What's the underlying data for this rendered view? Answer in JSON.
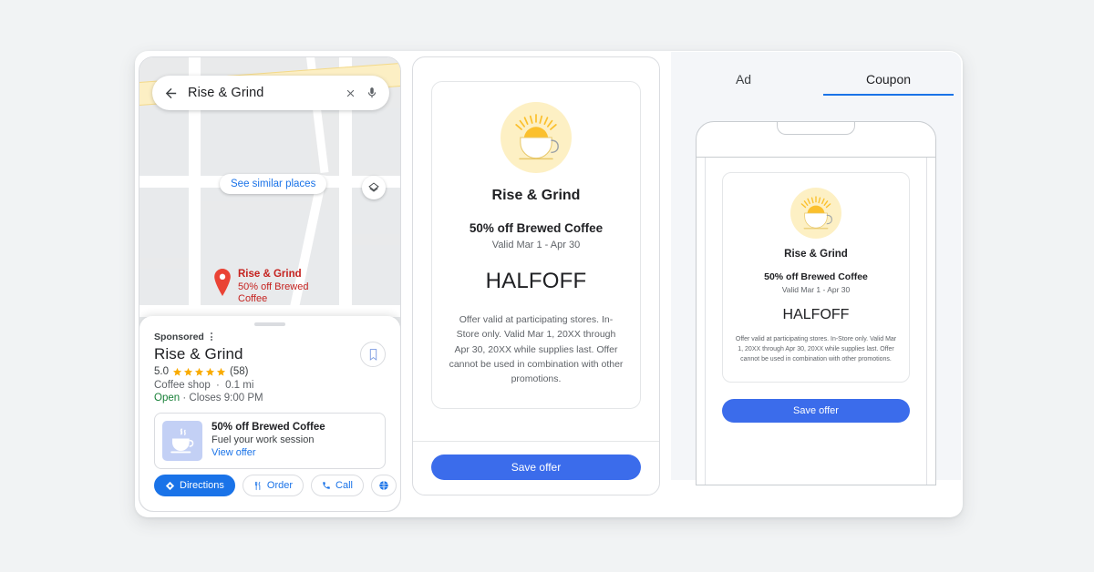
{
  "map_panel": {
    "search": {
      "value": "Rise & Grind",
      "back_icon": "back-arrow-icon",
      "clear_icon": "close-icon",
      "mic_icon": "microphone-icon"
    },
    "similar_chip": "See similar places",
    "layers_icon": "layers-icon",
    "locate_icon": "my-location-icon",
    "poi": {
      "title": "Rise & Grind",
      "subtitle": "50% off Brewed Coffee",
      "pin_icon": "map-pin-icon"
    },
    "sheet": {
      "sponsored_label": "Sponsored",
      "more_icon": "kebab-menu-icon",
      "business_name": "Rise & Grind",
      "rating": "5.0",
      "stars": 5,
      "review_count": "(58)",
      "category": "Coffee shop",
      "distance": "0.1 mi",
      "open_status": "Open",
      "closes": "Closes 9:00 PM",
      "bookmark_icon": "bookmark-icon",
      "offer": {
        "thumb_icon": "coffee-cup-icon",
        "title": "50% off Brewed Coffee",
        "subtitle": "Fuel your work session",
        "link": "View offer"
      },
      "actions": [
        {
          "label": "Directions",
          "icon": "directions-icon",
          "primary": true
        },
        {
          "label": "Order",
          "icon": "cutlery-icon",
          "primary": false
        },
        {
          "label": "Call",
          "icon": "phone-icon",
          "primary": false
        },
        {
          "label": "",
          "icon": "globe-icon",
          "primary": false
        }
      ]
    }
  },
  "coupon_panel": {
    "logo_icon": "sunrise-coffee-logo",
    "business_name": "Rise & Grind",
    "offer_title": "50% off Brewed Coffee",
    "valid": "Valid Mar 1 - Apr 30",
    "code": "HALFOFF",
    "terms": "Offer valid at participating stores. In-Store only. Valid Mar 1, 20XX through Apr 30, 20XX while supplies last. Offer cannot be used in combination with other promotions.",
    "save_label": "Save offer"
  },
  "preview_panel": {
    "tabs": [
      {
        "label": "Ad",
        "active": false
      },
      {
        "label": "Coupon",
        "active": true
      }
    ],
    "mock": {
      "logo_icon": "sunrise-coffee-logo",
      "business_name": "Rise & Grind",
      "offer_title": "50% off Brewed Coffee",
      "valid": "Valid Mar 1 - Apr 30",
      "code": "HALFOFF",
      "terms": "Offer valid at participating stores. In-Store only. Valid Mar 1, 20XX through Apr 30, 20XX while supplies last. Offer cannot be used in combination with other promotions.",
      "save_label": "Save offer"
    }
  },
  "colors": {
    "blue": "#1a73e8",
    "button_blue": "#3b6ceb",
    "red": "#c5221f",
    "green": "#188038",
    "star_gold": "#f9ab00",
    "logo_yellow": "#fbc02d",
    "logo_bg": "#fdf0c4"
  }
}
